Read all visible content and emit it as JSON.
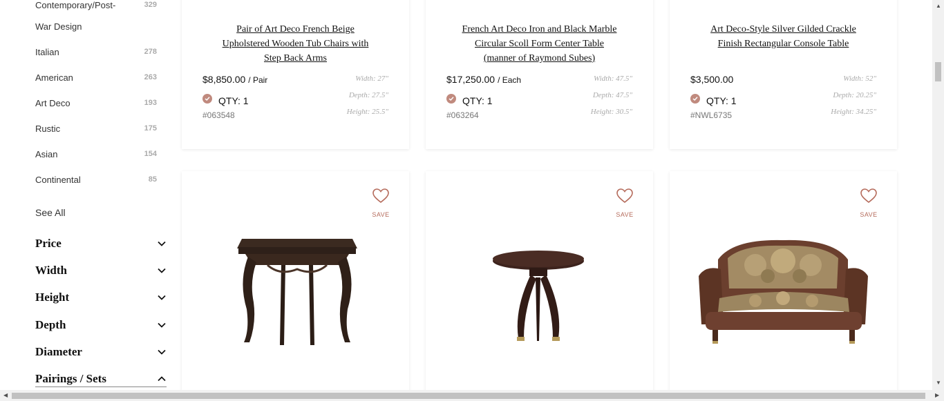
{
  "sidebar": {
    "styles": [
      {
        "label": "Contemporary/Post-",
        "count": "329"
      },
      {
        "label": "War Design",
        "count": ""
      },
      {
        "label": "Italian",
        "count": "278"
      },
      {
        "label": "American",
        "count": "263"
      },
      {
        "label": "Art Deco",
        "count": "193"
      },
      {
        "label": "Rustic",
        "count": "175"
      },
      {
        "label": "Asian",
        "count": "154"
      },
      {
        "label": "Continental",
        "count": "85"
      }
    ],
    "see_all": "See All",
    "sections": [
      {
        "label": "Price",
        "state": "collapsed"
      },
      {
        "label": "Width",
        "state": "collapsed"
      },
      {
        "label": "Height",
        "state": "collapsed"
      },
      {
        "label": "Depth",
        "state": "collapsed"
      },
      {
        "label": "Diameter",
        "state": "collapsed"
      },
      {
        "label": "Pairings / Sets",
        "state": "expanded"
      }
    ]
  },
  "products_top": [
    {
      "title": "Pair of Art Deco French Beige Upholstered Wooden Tub Chairs with Step Back Arms",
      "title_lines": [
        "Pair of Art Deco French Beige",
        "Upholstered Wooden Tub Chairs with",
        "Step Back Arms"
      ],
      "price": "$8,850.00",
      "unit": "/ Pair",
      "qty": "QTY: 1",
      "sku": "#063548",
      "width": "Width: 27\"",
      "depth": "Depth: 27.5\"",
      "height": "Height: 25.5\""
    },
    {
      "title": "French Art Deco Iron and Black Marble Circular Scoll Form Center Table (manner of Raymond Subes)",
      "title_lines": [
        "French Art Deco Iron and Black Marble",
        "Circular Scoll Form Center Table",
        "(manner of Raymond Subes)"
      ],
      "price": "$17,250.00",
      "unit": "/ Each",
      "qty": "QTY: 1",
      "sku": "#063264",
      "width": "Width: 47.5\"",
      "depth": "Depth: 47.5\"",
      "height": "Height: 30.5\""
    },
    {
      "title": "Art Deco-Style Silver Gilded Crackle Finish Rectangular Console Table",
      "title_lines": [
        "Art Deco-Style Silver Gilded Crackle",
        "Finish Rectangular Console Table"
      ],
      "price": "$3,500.00",
      "unit": "",
      "qty": "QTY: 1",
      "sku": "#NWL6735",
      "width": "Width: 52\"",
      "depth": "Depth: 20.25\"",
      "height": "Height: 34.25\""
    }
  ],
  "products_bottom": [
    {
      "save_label": "SAVE",
      "image": "dark-wood-side-table"
    },
    {
      "save_label": "SAVE",
      "image": "round-art-deco-pedestal-table"
    },
    {
      "save_label": "SAVE",
      "image": "tapestry-upholstered-settee"
    }
  ],
  "colors": {
    "accent": "#c08a7e",
    "save_text": "#b56b5b",
    "dimension_text": "#aaaaaa"
  }
}
